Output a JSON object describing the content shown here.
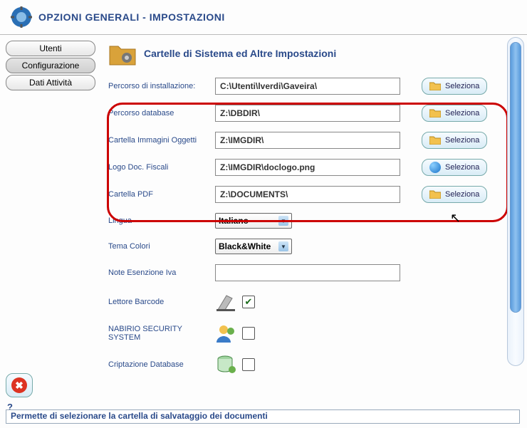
{
  "window": {
    "title": "OPZIONI GENERALI - IMPOSTAZIONI"
  },
  "tabs": {
    "utenti": "Utenti",
    "configurazione": "Configurazione",
    "dati_attivita": "Dati Attività"
  },
  "panel": {
    "heading": "Cartelle di Sistema ed Altre Impostazioni"
  },
  "fields": {
    "install": {
      "label": "Percorso di installazione:",
      "value": "C:\\Utenti\\lverdi\\Gaveira\\",
      "button": "Seleziona"
    },
    "db": {
      "label": "Percorso database",
      "value": "Z:\\DBDIR\\",
      "button": "Seleziona"
    },
    "img": {
      "label": "Cartella Immagini Oggetti",
      "value": "Z:\\IMGDIR\\",
      "button": "Seleziona"
    },
    "logo": {
      "label": "Logo Doc. Fiscali",
      "value": "Z:\\IMGDIR\\doclogo.png",
      "button": "Seleziona"
    },
    "pdf": {
      "label": "Cartella PDF",
      "value": "Z:\\DOCUMENTS\\",
      "button": "Seleziona"
    },
    "lingua": {
      "label": "Lingua",
      "value": "Italiano"
    },
    "tema": {
      "label": "Tema Colori",
      "value": "Black&White"
    },
    "note": {
      "label": "Note Esenzione Iva",
      "value": ""
    },
    "barcode": {
      "label": "Lettore Barcode",
      "checked": true
    },
    "nabirio": {
      "label": "NABIRIO SECURITY SYSTEM",
      "checked": false
    },
    "cripto": {
      "label": "Criptazione Database",
      "checked": false
    }
  },
  "help": {
    "q": "?",
    "status": "Permette di selezionare la cartella di salvataggio dei documenti"
  }
}
